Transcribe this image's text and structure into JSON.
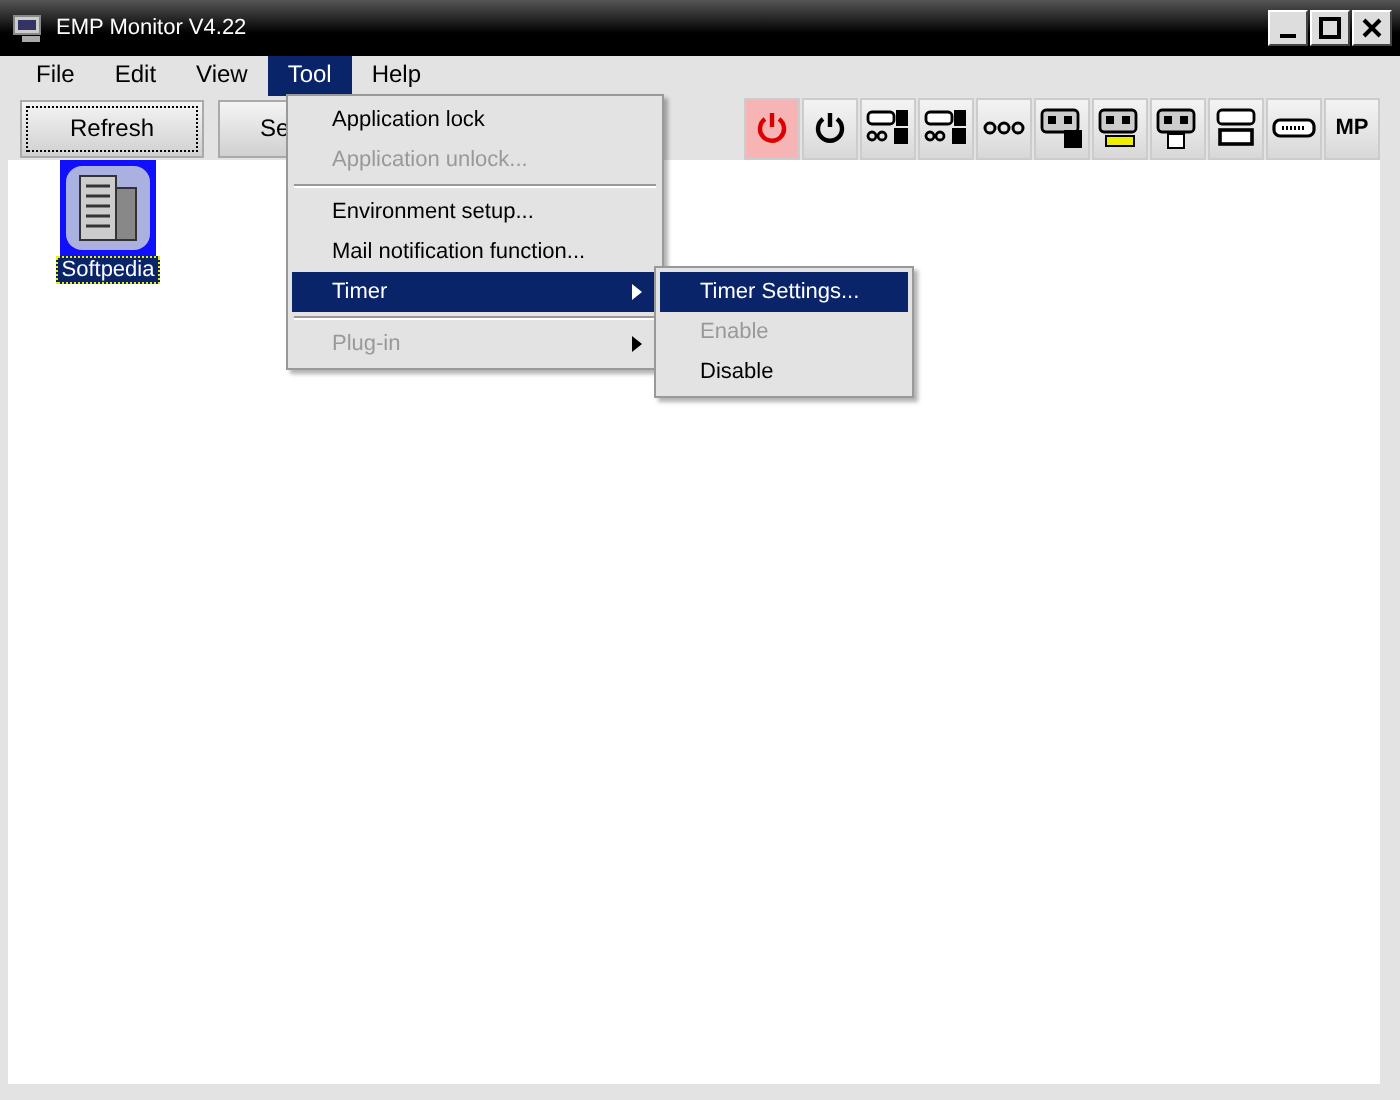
{
  "window": {
    "title": "EMP Monitor V4.22"
  },
  "menu_bar": [
    {
      "label": "File",
      "selected": false
    },
    {
      "label": "Edit",
      "selected": false
    },
    {
      "label": "View",
      "selected": false
    },
    {
      "label": "Tool",
      "selected": true
    },
    {
      "label": "Help",
      "selected": false
    }
  ],
  "toolbar": {
    "buttons": [
      {
        "label": "Refresh",
        "focused": true
      },
      {
        "label": "Se",
        "focused": false
      }
    ],
    "icon_buttons": [
      {
        "kind": "power",
        "on": true
      },
      {
        "kind": "power",
        "on": false
      },
      {
        "kind": "port-1a"
      },
      {
        "kind": "port-2b"
      },
      {
        "kind": "dots"
      },
      {
        "kind": "tape-s"
      },
      {
        "kind": "tape-plug"
      },
      {
        "kind": "tape-cable"
      },
      {
        "kind": "hdmi"
      },
      {
        "kind": "serial"
      },
      {
        "kind": "text",
        "label": "MP"
      }
    ]
  },
  "devices": [
    {
      "label": "Softpedia",
      "selected": true
    }
  ],
  "tool_menu": [
    {
      "kind": "item",
      "label": "Application lock",
      "disabled": false,
      "highlighted": false,
      "submenu": false
    },
    {
      "kind": "item",
      "label": "Application unlock...",
      "disabled": true,
      "highlighted": false,
      "submenu": false
    },
    {
      "kind": "separator"
    },
    {
      "kind": "item",
      "label": "Environment setup...",
      "disabled": false,
      "highlighted": false,
      "submenu": false
    },
    {
      "kind": "item",
      "label": "Mail notification function...",
      "disabled": false,
      "highlighted": false,
      "submenu": false
    },
    {
      "kind": "item",
      "label": "Timer",
      "disabled": false,
      "highlighted": true,
      "submenu": true
    },
    {
      "kind": "separator"
    },
    {
      "kind": "item",
      "label": "Plug-in",
      "disabled": true,
      "highlighted": false,
      "submenu": true
    }
  ],
  "timer_submenu": [
    {
      "label": "Timer Settings...",
      "disabled": false,
      "highlighted": true
    },
    {
      "label": "Enable",
      "disabled": true,
      "highlighted": false
    },
    {
      "label": "Disable",
      "disabled": false,
      "highlighted": false
    }
  ]
}
